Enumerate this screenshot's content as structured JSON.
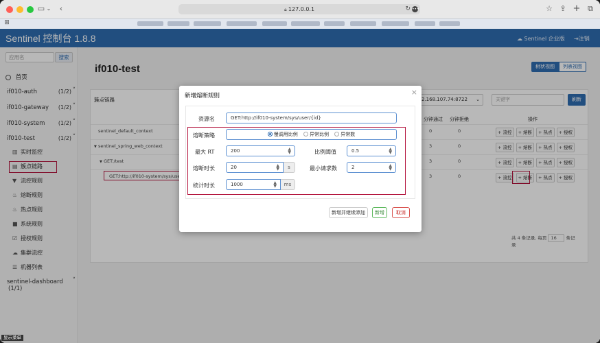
{
  "browser": {
    "url": "127.0.0.1"
  },
  "app": {
    "brand": "Sentinel 控制台 1.8.8",
    "enterprise_link": "Sentinel 企业版",
    "logout_link": "注销"
  },
  "sidebar": {
    "search_placeholder": "应用名",
    "search_button": "搜索",
    "home": "首页",
    "apps": [
      {
        "name": "if010-auth",
        "count": "(1/2)"
      },
      {
        "name": "if010-gateway",
        "count": "(1/2)"
      },
      {
        "name": "if010-system",
        "count": "(1/2)"
      },
      {
        "name": "if010-test",
        "count": "(1/2)"
      }
    ],
    "sub_items": [
      {
        "label": "实时监控",
        "icon": "chart-icon"
      },
      {
        "label": "簇点链路",
        "icon": "list-icon"
      },
      {
        "label": "流控规则",
        "icon": "filter-icon"
      },
      {
        "label": "熔断规则",
        "icon": "fire-icon"
      },
      {
        "label": "热点规则",
        "icon": "flame-icon"
      },
      {
        "label": "系统规则",
        "icon": "lock-icon"
      },
      {
        "label": "授权规则",
        "icon": "check-icon"
      },
      {
        "label": "集群流控",
        "icon": "cloud-icon"
      },
      {
        "label": "机器列表",
        "icon": "list-icon"
      }
    ],
    "dashboard": {
      "name": "sentinel-dashboard",
      "count": "(1/1)"
    }
  },
  "main": {
    "title": "if010-test",
    "view_tree": "树状视图",
    "view_list": "列表视图",
    "panel_title": "簇点链路",
    "ip_select": "2.168.107.74:8722",
    "keyword_placeholder": "关键字",
    "refresh_button": "刷新",
    "headers": {
      "pass_qps": "分钟通过",
      "block_qps": "分钟拒绝",
      "ops": "操作"
    },
    "rows": [
      {
        "name": "sentinel_default_context",
        "prefix": "",
        "pass": "0",
        "block": "0"
      },
      {
        "name": "sentinel_spring_web_context",
        "prefix": "▼",
        "pass": "3",
        "block": "0"
      },
      {
        "name": "GET:/test",
        "prefix": "▼",
        "pass": "3",
        "block": "0"
      },
      {
        "name": "GET:http://if010-system/sys/user/{id}",
        "prefix": "",
        "pass": "3",
        "block": "0"
      }
    ],
    "op_labels": {
      "flow": "+ 流控",
      "degrade": "+ 熔断",
      "hot": "+ 热点",
      "auth": "+ 授权"
    },
    "pager": {
      "text_before": "共 4 条记录, 每页",
      "page_size": "16",
      "text_after": "条记",
      "text_tail": "录"
    }
  },
  "modal": {
    "title": "新增熔断规则",
    "resource_label": "资源名",
    "resource_value": "GET:http://if010-system/sys/user/{id}",
    "strategy_label": "熔断策略",
    "strategy_options": [
      "慢调用比例",
      "异常比例",
      "异常数"
    ],
    "max_rt_label": "最大 RT",
    "max_rt_value": "200",
    "ratio_label": "比例阈值",
    "ratio_value": "0.5",
    "duration_label": "熔断时长",
    "duration_value": "20",
    "duration_unit": "s",
    "min_req_label": "最小请求数",
    "min_req_value": "2",
    "stat_label": "统计时长",
    "stat_value": "1000",
    "stat_unit": "ms",
    "btn_add_continue": "新增并继续添加",
    "btn_add": "新增",
    "btn_cancel": "取消"
  },
  "bottom_tip": "显示菜单",
  "colors": {
    "brand": "#2f6cb0",
    "highlight": "#b3123c",
    "success": "#5cb85c",
    "danger": "#d9534f"
  }
}
